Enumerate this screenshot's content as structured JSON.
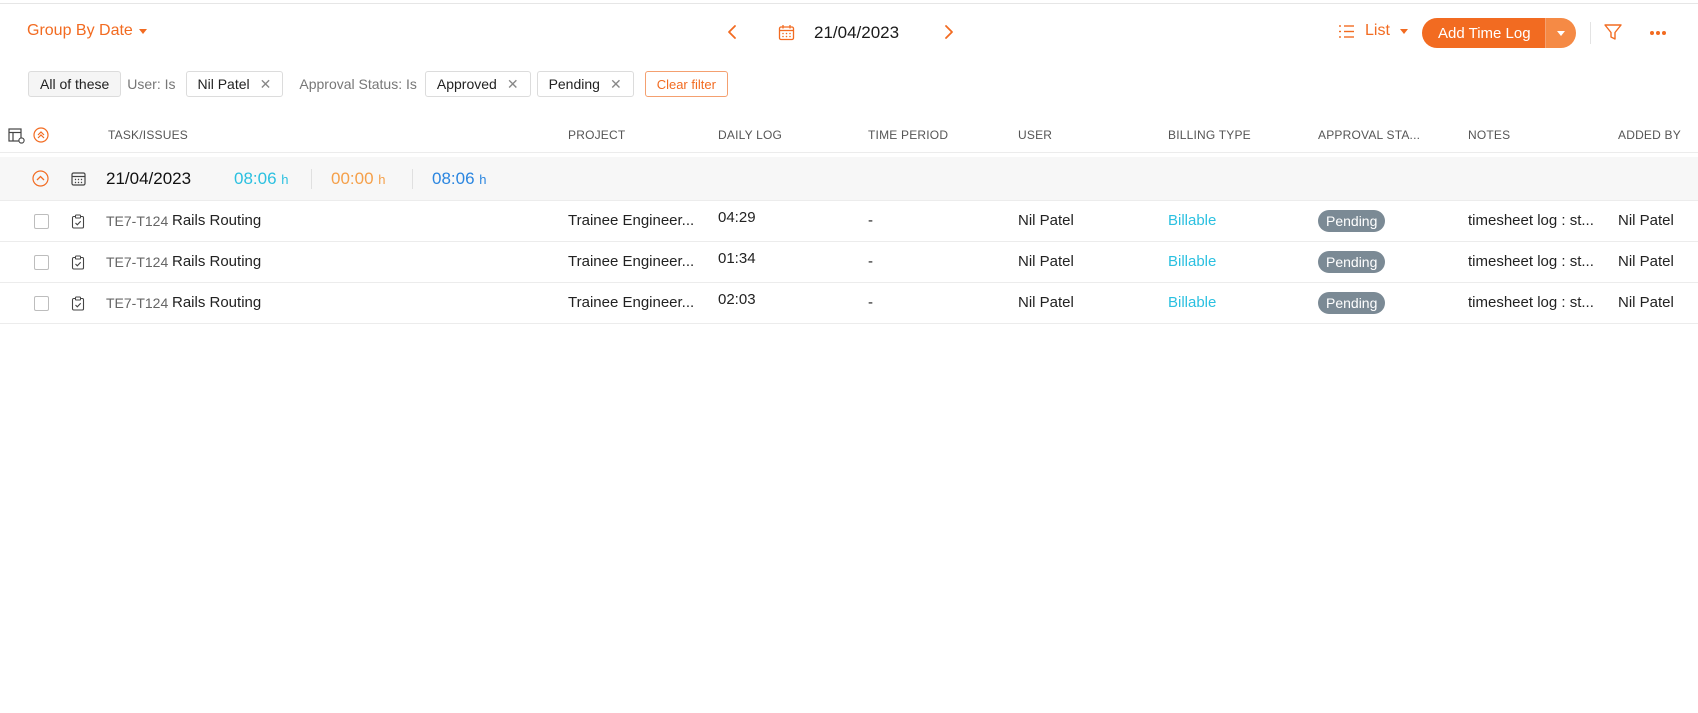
{
  "toolbar": {
    "group_by_label": "Group By Date",
    "current_date": "21/04/2023",
    "view_label": "List",
    "add_button_label": "Add Time Log"
  },
  "filters": {
    "match_label": "All of these",
    "user_label": "User: Is",
    "user_value": "Nil Patel",
    "approval_label": "Approval Status: Is",
    "approval_values": [
      "Approved",
      "Pending"
    ],
    "clear_label": "Clear filter"
  },
  "columns": {
    "task": "TASK/ISSUES",
    "project": "PROJECT",
    "daily_log": "DAILY LOG",
    "time_period": "TIME PERIOD",
    "user": "USER",
    "billing_type": "BILLING TYPE",
    "approval_status": "APPROVAL STA...",
    "notes": "NOTES",
    "added_by": "ADDED BY"
  },
  "group": {
    "date": "21/04/2023",
    "totals": [
      {
        "value": "08:06",
        "unit": "h",
        "color": "#2bc0e0"
      },
      {
        "value": "00:00",
        "unit": "h",
        "color": "#f5a04a"
      },
      {
        "value": "08:06",
        "unit": "h",
        "color": "#2b86e0"
      }
    ]
  },
  "rows": [
    {
      "id": "TE7-T124",
      "name": "Rails Routing",
      "project": "Trainee Engineer...",
      "daily_log": "04:29",
      "time_period": "-",
      "user": "Nil Patel",
      "billing": "Billable",
      "approval": "Pending",
      "notes": "timesheet log : st...",
      "added_by": "Nil Patel"
    },
    {
      "id": "TE7-T124",
      "name": "Rails Routing",
      "project": "Trainee Engineer...",
      "daily_log": "01:34",
      "time_period": "-",
      "user": "Nil Patel",
      "billing": "Billable",
      "approval": "Pending",
      "notes": "timesheet log : st...",
      "added_by": "Nil Patel"
    },
    {
      "id": "TE7-T124",
      "name": "Rails Routing",
      "project": "Trainee Engineer...",
      "daily_log": "02:03",
      "time_period": "-",
      "user": "Nil Patel",
      "billing": "Billable",
      "approval": "Pending",
      "notes": "timesheet log : st...",
      "added_by": "Nil Patel"
    }
  ],
  "colors": {
    "accent": "#f26b21",
    "billable": "#2bc0e0",
    "pending_badge": "#7b8a95"
  }
}
